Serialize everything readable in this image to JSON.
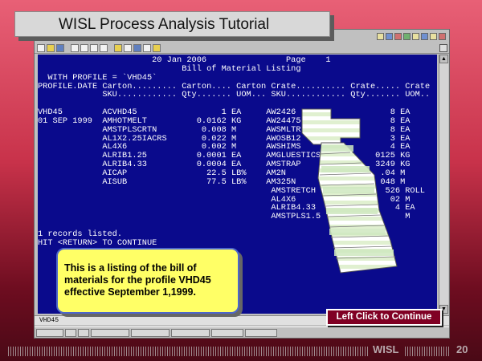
{
  "slide": {
    "title": "WISL Process Analysis Tutorial",
    "footer_label": "WISL",
    "page_number": "20"
  },
  "terminal": {
    "lines": [
      "                       20 Jan 2006                Page    1",
      "                             Bill of Material Listing",
      "  WITH PROFILE = `VHD45`",
      "PROFILE.DATE Carton......... Carton.... Carton Crate.......... Crate..... Crate",
      "             SKU............ Qty....... UOM... SKU............ Qty....... UOM..",
      "",
      "VHD45        ACVHD45                 1 EA     AW2426                   8 EA",
      "01 SEP 1999  AMHOTMELT          0.0162 KG     AW24475                  8 EA",
      "             AMSTPLSCRTN         0.008 M      AWSMLTRI                 8 EA",
      "             AL1X2.25IACRS       0.022 M      AWOSB12                  3 EA",
      "             AL4X6               0.002 M      AWSHIMS                  4 EA",
      "             ALRIB1.25          0.0001 EA     AMGLUESTICS           0125 KG",
      "             ALRIB4.33          0.0004 EA     AMSTRAP               3249 KG",
      "             AICAP                22.5 LB%    AM2N                   .04 M",
      "             AISUB                77.5 LB%    AM325N                 048 M",
      "                                               AMSTRETCH              526 ROLL",
      "                                               AL4X6                   02 M",
      "                                               ALRIB4.33                4 EA",
      "                                               AMSTPLS1.5                 M",
      "",
      "1 records listed.",
      "HIT <RETURN> TO CONTINUE"
    ],
    "status_bar_text": "VHD45"
  },
  "note": {
    "text": "This is a listing of the bill of materials for the profile VHD45 effective September 1,1999."
  },
  "continue_button": {
    "label": "Left Click to Continue"
  },
  "colors": {
    "terminal_bg": "#0a0a8c",
    "note_bg": "#ffff66",
    "button_bg": "#800024"
  }
}
